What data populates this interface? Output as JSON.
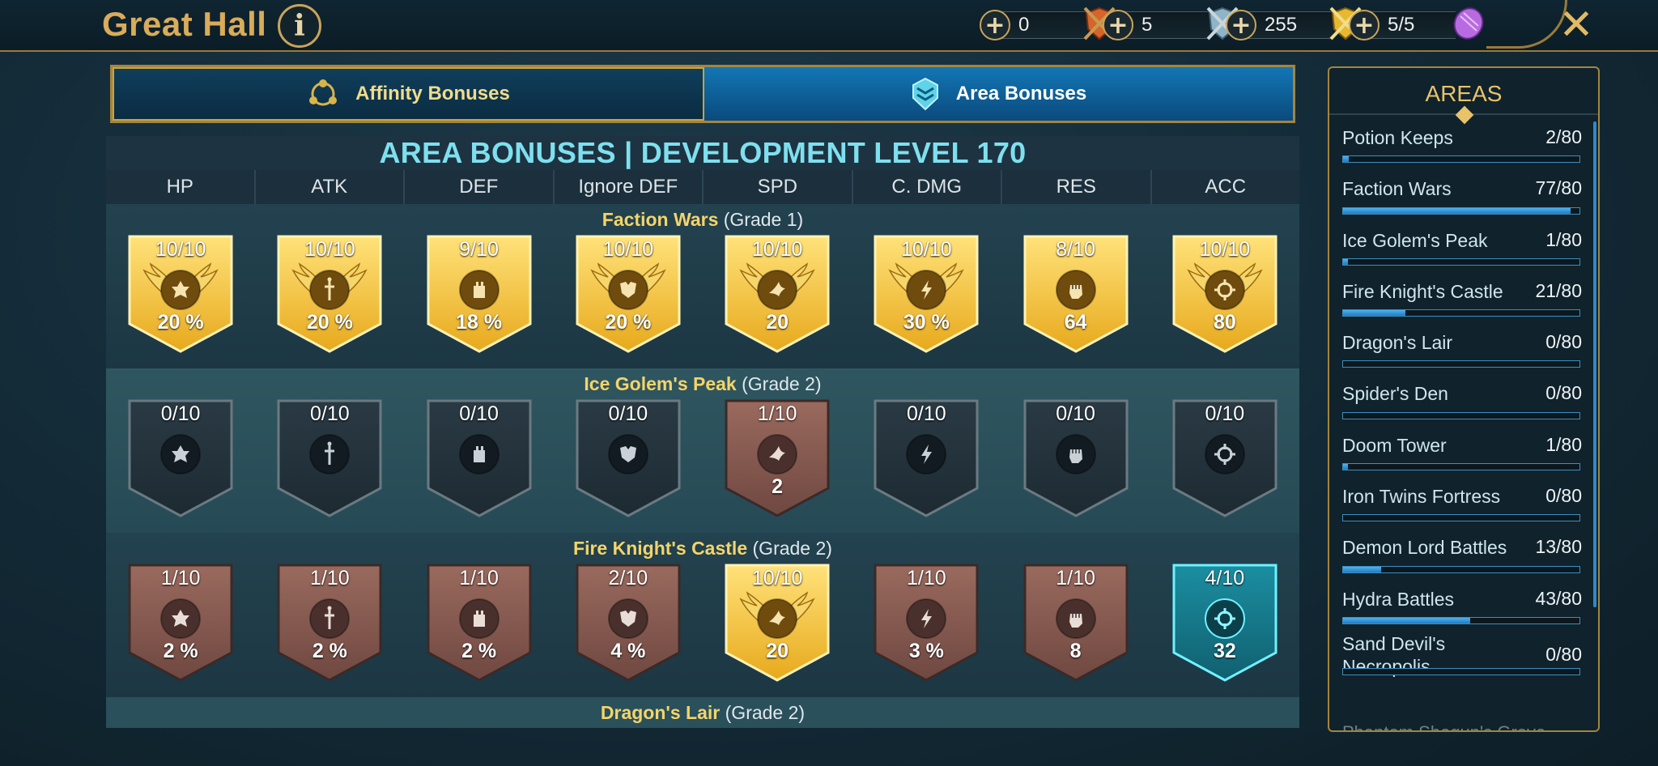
{
  "header": {
    "title": "Great Hall",
    "info_icon": "info-icon",
    "close_icon": "close-icon",
    "resources": [
      {
        "value": "0",
        "icon": "orange-shield-swords-icon",
        "color": "#d5652a"
      },
      {
        "value": "5",
        "icon": "silver-shield-swords-icon",
        "color": "#8fb4c6"
      },
      {
        "value": "255",
        "icon": "gold-shield-swords-icon",
        "color": "#e6b92e"
      },
      {
        "value": "5/5",
        "icon": "purple-gem-icon",
        "color": "#b86be0"
      }
    ]
  },
  "tabs": [
    {
      "label": "Affinity Bonuses",
      "icon": "affinity-icon",
      "active": false
    },
    {
      "label": "Area Bonuses",
      "icon": "area-bonus-icon",
      "active": true
    }
  ],
  "main": {
    "heading": "AREA BONUSES | DEVELOPMENT LEVEL 170",
    "columns": [
      "HP",
      "ATK",
      "DEF",
      "Ignore DEF",
      "SPD",
      "C. DMG",
      "RES",
      "ACC"
    ],
    "column_icons": [
      "hp-icon",
      "atk-sword-icon",
      "def-tower-icon",
      "ignore-def-icon",
      "spd-bird-icon",
      "crit-dmg-icon",
      "res-fist-icon",
      "acc-crosshair-icon"
    ],
    "sections": [
      {
        "name": "Faction Wars",
        "grade": "(Grade 1)",
        "badges": [
          {
            "level": "10/10",
            "value": "20 %",
            "style": "gold"
          },
          {
            "level": "10/10",
            "value": "20 %",
            "style": "gold"
          },
          {
            "level": "9/10",
            "value": "18 %",
            "style": "gold-plain"
          },
          {
            "level": "10/10",
            "value": "20 %",
            "style": "gold"
          },
          {
            "level": "10/10",
            "value": "20",
            "style": "gold"
          },
          {
            "level": "10/10",
            "value": "30 %",
            "style": "gold"
          },
          {
            "level": "8/10",
            "value": "64",
            "style": "gold-plain"
          },
          {
            "level": "10/10",
            "value": "80",
            "style": "gold"
          }
        ]
      },
      {
        "name": "Ice Golem's Peak",
        "grade": "(Grade 2)",
        "badges": [
          {
            "level": "0/10",
            "value": "",
            "style": "dark"
          },
          {
            "level": "0/10",
            "value": "",
            "style": "dark"
          },
          {
            "level": "0/10",
            "value": "",
            "style": "dark"
          },
          {
            "level": "0/10",
            "value": "",
            "style": "dark"
          },
          {
            "level": "1/10",
            "value": "2",
            "style": "bronze"
          },
          {
            "level": "0/10",
            "value": "",
            "style": "dark"
          },
          {
            "level": "0/10",
            "value": "",
            "style": "dark"
          },
          {
            "level": "0/10",
            "value": "",
            "style": "dark"
          }
        ]
      },
      {
        "name": "Fire Knight's Castle",
        "grade": "(Grade 2)",
        "badges": [
          {
            "level": "1/10",
            "value": "2 %",
            "style": "bronze"
          },
          {
            "level": "1/10",
            "value": "2 %",
            "style": "bronze"
          },
          {
            "level": "1/10",
            "value": "2 %",
            "style": "bronze"
          },
          {
            "level": "2/10",
            "value": "4 %",
            "style": "bronze"
          },
          {
            "level": "10/10",
            "value": "20",
            "style": "gold"
          },
          {
            "level": "1/10",
            "value": "3 %",
            "style": "bronze"
          },
          {
            "level": "1/10",
            "value": "8",
            "style": "bronze"
          },
          {
            "level": "4/10",
            "value": "32",
            "style": "teal"
          }
        ]
      },
      {
        "name": "Dragon's Lair",
        "grade": "(Grade 2)",
        "badges": []
      }
    ]
  },
  "areas_panel": {
    "title": "AREAS",
    "items": [
      {
        "name": "Potion Keeps",
        "count": "2/80",
        "progress": 0.025
      },
      {
        "name": "Faction Wars",
        "count": "77/80",
        "progress": 0.9625
      },
      {
        "name": "Ice Golem's Peak",
        "count": "1/80",
        "progress": 0.0125
      },
      {
        "name": "Fire Knight's Castle",
        "count": "21/80",
        "progress": 0.2625
      },
      {
        "name": "Dragon's Lair",
        "count": "0/80",
        "progress": 0
      },
      {
        "name": "Spider's Den",
        "count": "0/80",
        "progress": 0
      },
      {
        "name": "Doom Tower",
        "count": "1/80",
        "progress": 0.0125
      },
      {
        "name": "Iron Twins Fortress",
        "count": "0/80",
        "progress": 0
      },
      {
        "name": "Demon Lord Battles",
        "count": "13/80",
        "progress": 0.1625
      },
      {
        "name": "Hydra Battles",
        "count": "43/80",
        "progress": 0.5375
      },
      {
        "name": "Sand Devil's Necropolis",
        "count": "0/80",
        "progress": 0
      }
    ],
    "partial_item": "Phantom Shogun's Grove"
  }
}
